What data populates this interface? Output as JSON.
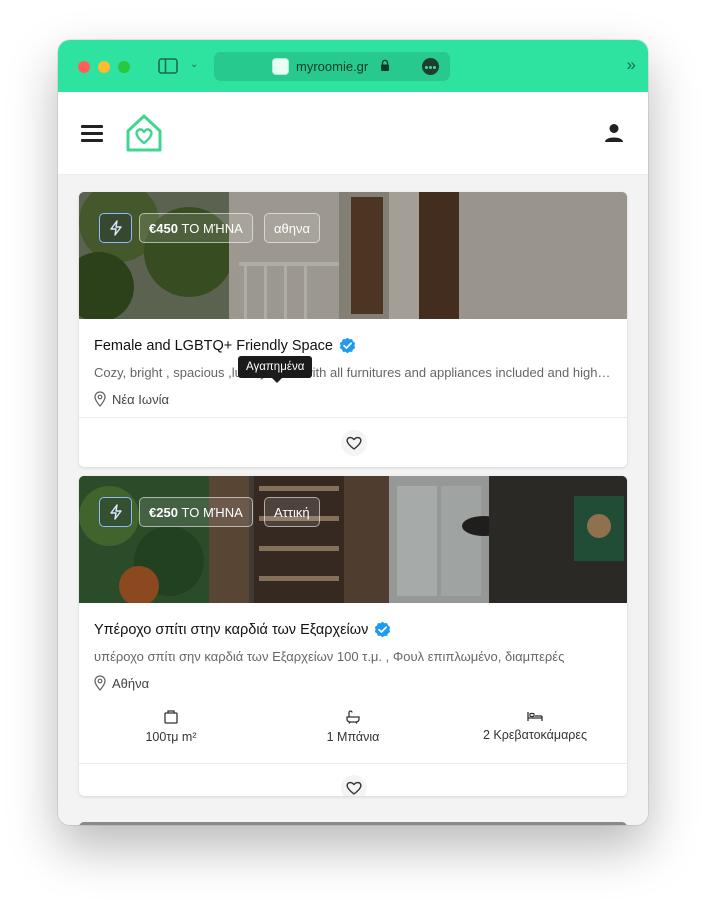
{
  "browser": {
    "url": "myroomie.gr",
    "theme_color": "#2ee3a0",
    "lock_icon": "lock-icon"
  },
  "header": {
    "menu_icon": "hamburger-icon",
    "logo_icon": "house-heart-logo",
    "user_icon": "user-icon"
  },
  "listings": [
    {
      "price": "€450",
      "price_suffix": "ΤΟ ΜΉΝΑ",
      "region": "αθηνα",
      "title": "Female and LGBTQ+ Friendly Space",
      "description": "Cozy, bright , spacious ,luxury room with all furnitures and appliances included and high speed internet",
      "location": "Νέα Ιωνία",
      "verified": true
    },
    {
      "price": "€250",
      "price_suffix": "ΤΟ ΜΉΝΑ",
      "region": "Αττική",
      "title": "Υπέροχο σπίτι στην καρδιά των Εξαρχείων",
      "description": "υπέροχο σπίτι σην καρδιά των Εξαρχείων 100 τ.μ. , Φουλ επιπλωμένο, διαμπερές",
      "location": "Αθήνα",
      "verified": true,
      "features": {
        "area": "100τμ m²",
        "baths": "1 Μπάνια",
        "bedrooms": "2 Κρεβατοκάμαρες"
      }
    }
  ],
  "tooltip": "Αγαπημένα"
}
